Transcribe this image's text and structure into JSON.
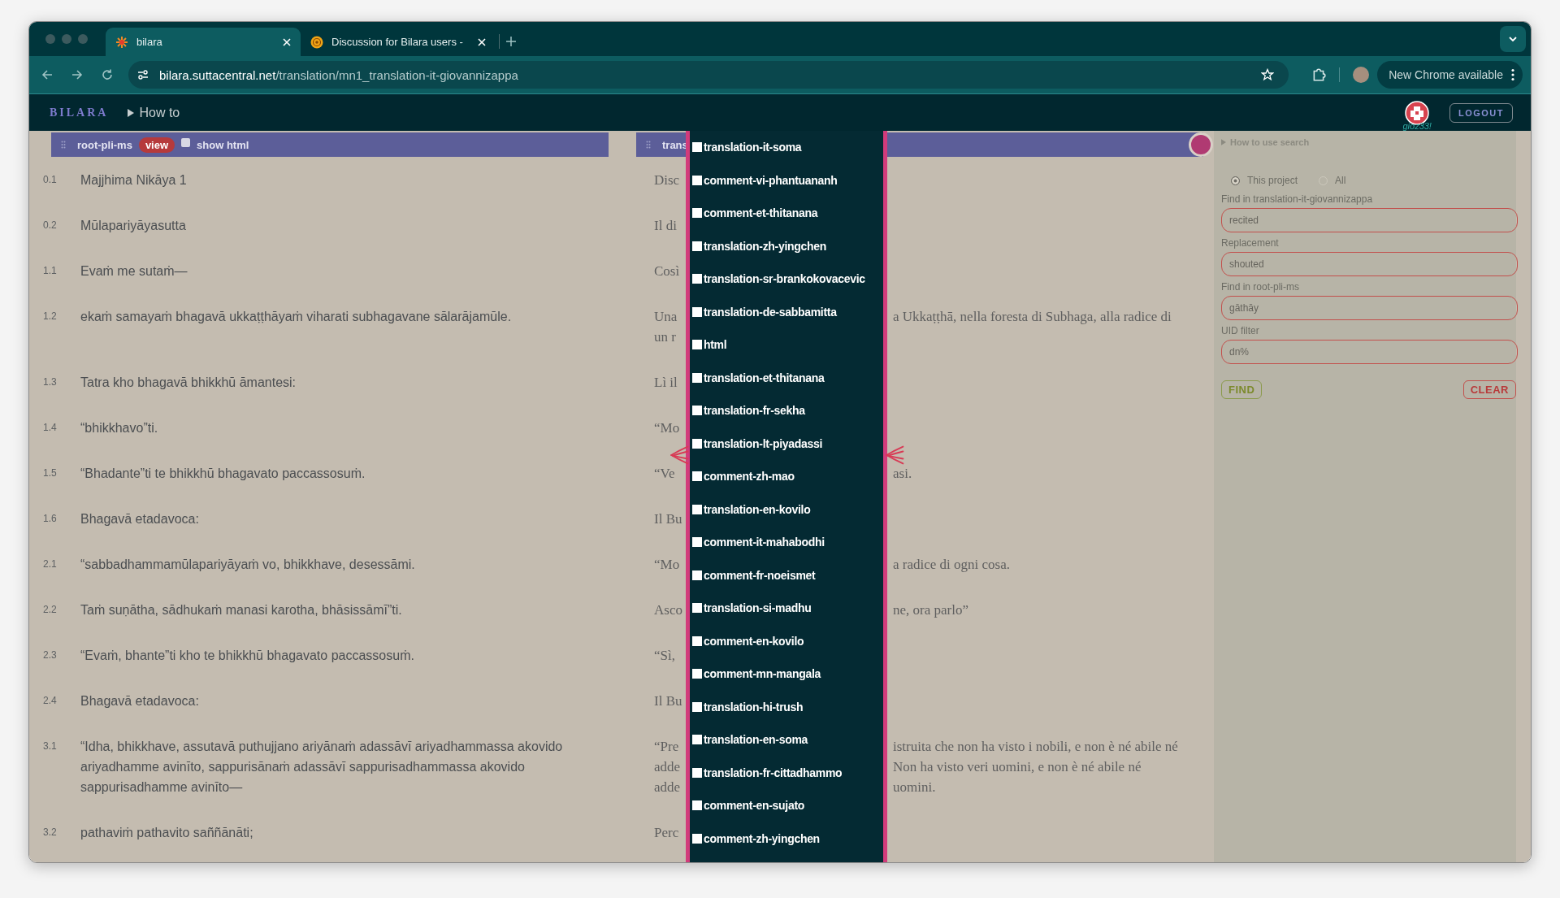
{
  "browser": {
    "tabs": [
      {
        "title": "bilara",
        "selected": true
      },
      {
        "title": "Discussion for Bilara users -",
        "selected": false
      }
    ],
    "url_host": "bilara.suttacentral.net",
    "url_path": "/translation/mn1_translation-it-giovannizappa",
    "update_label": "New Chrome available"
  },
  "app": {
    "logo": "BILARA",
    "nav_link": "How to",
    "username": "gioz33!",
    "logout": "LOGOUT"
  },
  "root_column": {
    "name": "root-pli-ms",
    "view_label": "view",
    "show_html": {
      "label": "show html",
      "checked": false
    }
  },
  "translation_column": {
    "name": "trans"
  },
  "rows": [
    {
      "id": "0.1",
      "root": "Majjhima Nikāya 1",
      "trans_left": [
        "Disc"
      ],
      "trans_right": []
    },
    {
      "id": "0.2",
      "root": "Mūlapariyāyasutta",
      "trans_left": [
        "Il di"
      ],
      "trans_right": []
    },
    {
      "id": "1.1",
      "root": "Evaṁ me sutaṁ—",
      "trans_left": [
        "Così"
      ],
      "trans_right": []
    },
    {
      "id": "1.2",
      "root": "ekaṁ samayaṁ bhagavā ukkaṭṭhāyaṁ viharati subhagavane sālarājamūle.",
      "trans_left": [
        "Una",
        "un r"
      ],
      "trans_right": [
        "a Ukkaṭṭhā, nella foresta di Subhaga, alla radice di"
      ]
    },
    {
      "id": "1.3",
      "root": "Tatra kho bhagavā bhikkhū āmantesi:",
      "trans_left": [
        "Lì il"
      ],
      "trans_right": []
    },
    {
      "id": "1.4",
      "root": "“bhikkhavo”ti.",
      "trans_left": [
        "“Mo"
      ],
      "trans_right": []
    },
    {
      "id": "1.5",
      "root": "“Bhadante”ti te bhikkhū bhagavato paccassosuṁ.",
      "trans_left": [
        "“Ve"
      ],
      "trans_right": [
        "asi."
      ]
    },
    {
      "id": "1.6",
      "root": "Bhagavā etadavoca:",
      "trans_left": [
        "Il Bu"
      ],
      "trans_right": []
    },
    {
      "id": "2.1",
      "root": "“sabbadhammamūlapariyāyaṁ vo, bhikkhave, desessāmi.",
      "trans_left": [
        "“Mo"
      ],
      "trans_right": [
        "a radice di ogni cosa."
      ]
    },
    {
      "id": "2.2",
      "root": "Taṁ suṇātha, sādhukaṁ manasi karotha, bhāsissāmī”ti.",
      "trans_left": [
        "Asco"
      ],
      "trans_right": [
        "ne, ora parlo”"
      ]
    },
    {
      "id": "2.3",
      "root": "“Evaṁ, bhante”ti kho te bhikkhū bhagavato paccassosuṁ.",
      "trans_left": [
        "“Sì,"
      ],
      "trans_right": []
    },
    {
      "id": "2.4",
      "root": "Bhagavā etadavoca:",
      "trans_left": [
        "Il Bu"
      ],
      "trans_right": []
    },
    {
      "id": "3.1",
      "root": "“Idha, bhikkhave, assutavā puthujjano ariyānaṁ adassāvī ariyadhammassa akovido ariyadhamme avinīto, sappurisānaṁ adassāvī sappurisadhammassa akovido sappurisadhamme avinīto—",
      "trans_left": [
        "“Pre",
        "adde",
        "adde"
      ],
      "trans_right": [
        "istruita che non ha visto i nobili, e non è né abile né",
        "Non ha visto veri uomini, e non è né abile né",
        "uomini."
      ]
    },
    {
      "id": "3.2",
      "root": "pathaviṁ pathavito saññānāti;",
      "trans_left": [
        "Perc"
      ],
      "trans_right": []
    }
  ],
  "dropdown": {
    "items": [
      {
        "label": "translation-it-soma",
        "checked": false
      },
      {
        "label": "comment-vi-phantuananh",
        "checked": false
      },
      {
        "label": "comment-et-thitanana",
        "checked": false
      },
      {
        "label": "translation-zh-yingchen",
        "checked": false
      },
      {
        "label": "translation-sr-brankokovacevic",
        "checked": false
      },
      {
        "label": "translation-de-sabbamitta",
        "checked": false
      },
      {
        "label": "html",
        "checked": false
      },
      {
        "label": "translation-et-thitanana",
        "checked": false
      },
      {
        "label": "translation-fr-sekha",
        "checked": false
      },
      {
        "label": "translation-lt-piyadassi",
        "checked": false
      },
      {
        "label": "comment-zh-mao",
        "checked": false
      },
      {
        "label": "translation-en-kovilo",
        "checked": false
      },
      {
        "label": "comment-it-mahabodhi",
        "checked": false
      },
      {
        "label": "comment-fr-noeismet",
        "checked": false
      },
      {
        "label": "translation-si-madhu",
        "checked": false
      },
      {
        "label": "comment-en-kovilo",
        "checked": false
      },
      {
        "label": "comment-mn-mangala",
        "checked": false
      },
      {
        "label": "translation-hi-trush",
        "checked": false
      },
      {
        "label": "translation-en-soma",
        "checked": false
      },
      {
        "label": "translation-fr-cittadhammo",
        "checked": false
      },
      {
        "label": "comment-en-sujato",
        "checked": false
      },
      {
        "label": "comment-zh-yingchen",
        "checked": false
      }
    ]
  },
  "search_panel": {
    "help": "How to use search",
    "scope": [
      {
        "label": "This project",
        "selected": true
      },
      {
        "label": "All",
        "selected": false
      }
    ],
    "fields": [
      {
        "label": "Find in translation-it-giovannizappa",
        "placeholder": "recited"
      },
      {
        "label": "Replacement",
        "placeholder": "shouted"
      },
      {
        "label": "Find in root-pli-ms",
        "placeholder": "gāthāy"
      },
      {
        "label": "UID filter",
        "placeholder": "dn%"
      }
    ],
    "find": "FIND",
    "clear": "CLEAR"
  }
}
